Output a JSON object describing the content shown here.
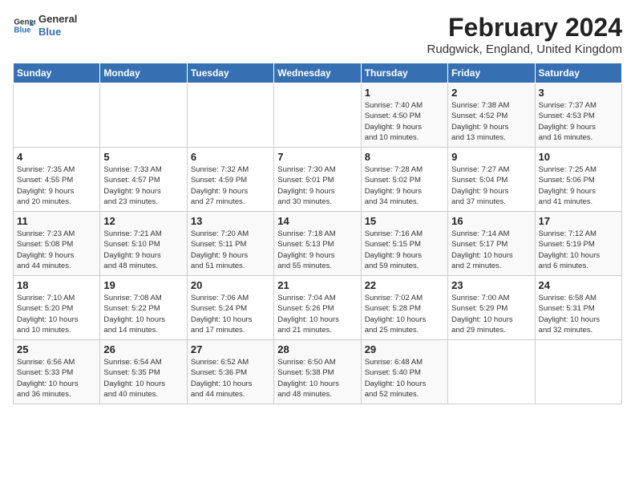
{
  "logo": {
    "line1": "General",
    "line2": "Blue"
  },
  "title": "February 2024",
  "subtitle": "Rudgwick, England, United Kingdom",
  "days_of_week": [
    "Sunday",
    "Monday",
    "Tuesday",
    "Wednesday",
    "Thursday",
    "Friday",
    "Saturday"
  ],
  "weeks": [
    [
      {
        "day": "",
        "info": ""
      },
      {
        "day": "",
        "info": ""
      },
      {
        "day": "",
        "info": ""
      },
      {
        "day": "",
        "info": ""
      },
      {
        "day": "1",
        "info": "Sunrise: 7:40 AM\nSunset: 4:50 PM\nDaylight: 9 hours\nand 10 minutes."
      },
      {
        "day": "2",
        "info": "Sunrise: 7:38 AM\nSunset: 4:52 PM\nDaylight: 9 hours\nand 13 minutes."
      },
      {
        "day": "3",
        "info": "Sunrise: 7:37 AM\nSunset: 4:53 PM\nDaylight: 9 hours\nand 16 minutes."
      }
    ],
    [
      {
        "day": "4",
        "info": "Sunrise: 7:35 AM\nSunset: 4:55 PM\nDaylight: 9 hours\nand 20 minutes."
      },
      {
        "day": "5",
        "info": "Sunrise: 7:33 AM\nSunset: 4:57 PM\nDaylight: 9 hours\nand 23 minutes."
      },
      {
        "day": "6",
        "info": "Sunrise: 7:32 AM\nSunset: 4:59 PM\nDaylight: 9 hours\nand 27 minutes."
      },
      {
        "day": "7",
        "info": "Sunrise: 7:30 AM\nSunset: 5:01 PM\nDaylight: 9 hours\nand 30 minutes."
      },
      {
        "day": "8",
        "info": "Sunrise: 7:28 AM\nSunset: 5:02 PM\nDaylight: 9 hours\nand 34 minutes."
      },
      {
        "day": "9",
        "info": "Sunrise: 7:27 AM\nSunset: 5:04 PM\nDaylight: 9 hours\nand 37 minutes."
      },
      {
        "day": "10",
        "info": "Sunrise: 7:25 AM\nSunset: 5:06 PM\nDaylight: 9 hours\nand 41 minutes."
      }
    ],
    [
      {
        "day": "11",
        "info": "Sunrise: 7:23 AM\nSunset: 5:08 PM\nDaylight: 9 hours\nand 44 minutes."
      },
      {
        "day": "12",
        "info": "Sunrise: 7:21 AM\nSunset: 5:10 PM\nDaylight: 9 hours\nand 48 minutes."
      },
      {
        "day": "13",
        "info": "Sunrise: 7:20 AM\nSunset: 5:11 PM\nDaylight: 9 hours\nand 51 minutes."
      },
      {
        "day": "14",
        "info": "Sunrise: 7:18 AM\nSunset: 5:13 PM\nDaylight: 9 hours\nand 55 minutes."
      },
      {
        "day": "15",
        "info": "Sunrise: 7:16 AM\nSunset: 5:15 PM\nDaylight: 9 hours\nand 59 minutes."
      },
      {
        "day": "16",
        "info": "Sunrise: 7:14 AM\nSunset: 5:17 PM\nDaylight: 10 hours\nand 2 minutes."
      },
      {
        "day": "17",
        "info": "Sunrise: 7:12 AM\nSunset: 5:19 PM\nDaylight: 10 hours\nand 6 minutes."
      }
    ],
    [
      {
        "day": "18",
        "info": "Sunrise: 7:10 AM\nSunset: 5:20 PM\nDaylight: 10 hours\nand 10 minutes."
      },
      {
        "day": "19",
        "info": "Sunrise: 7:08 AM\nSunset: 5:22 PM\nDaylight: 10 hours\nand 14 minutes."
      },
      {
        "day": "20",
        "info": "Sunrise: 7:06 AM\nSunset: 5:24 PM\nDaylight: 10 hours\nand 17 minutes."
      },
      {
        "day": "21",
        "info": "Sunrise: 7:04 AM\nSunset: 5:26 PM\nDaylight: 10 hours\nand 21 minutes."
      },
      {
        "day": "22",
        "info": "Sunrise: 7:02 AM\nSunset: 5:28 PM\nDaylight: 10 hours\nand 25 minutes."
      },
      {
        "day": "23",
        "info": "Sunrise: 7:00 AM\nSunset: 5:29 PM\nDaylight: 10 hours\nand 29 minutes."
      },
      {
        "day": "24",
        "info": "Sunrise: 6:58 AM\nSunset: 5:31 PM\nDaylight: 10 hours\nand 32 minutes."
      }
    ],
    [
      {
        "day": "25",
        "info": "Sunrise: 6:56 AM\nSunset: 5:33 PM\nDaylight: 10 hours\nand 36 minutes."
      },
      {
        "day": "26",
        "info": "Sunrise: 6:54 AM\nSunset: 5:35 PM\nDaylight: 10 hours\nand 40 minutes."
      },
      {
        "day": "27",
        "info": "Sunrise: 6:52 AM\nSunset: 5:36 PM\nDaylight: 10 hours\nand 44 minutes."
      },
      {
        "day": "28",
        "info": "Sunrise: 6:50 AM\nSunset: 5:38 PM\nDaylight: 10 hours\nand 48 minutes."
      },
      {
        "day": "29",
        "info": "Sunrise: 6:48 AM\nSunset: 5:40 PM\nDaylight: 10 hours\nand 52 minutes."
      },
      {
        "day": "",
        "info": ""
      },
      {
        "day": "",
        "info": ""
      }
    ]
  ]
}
